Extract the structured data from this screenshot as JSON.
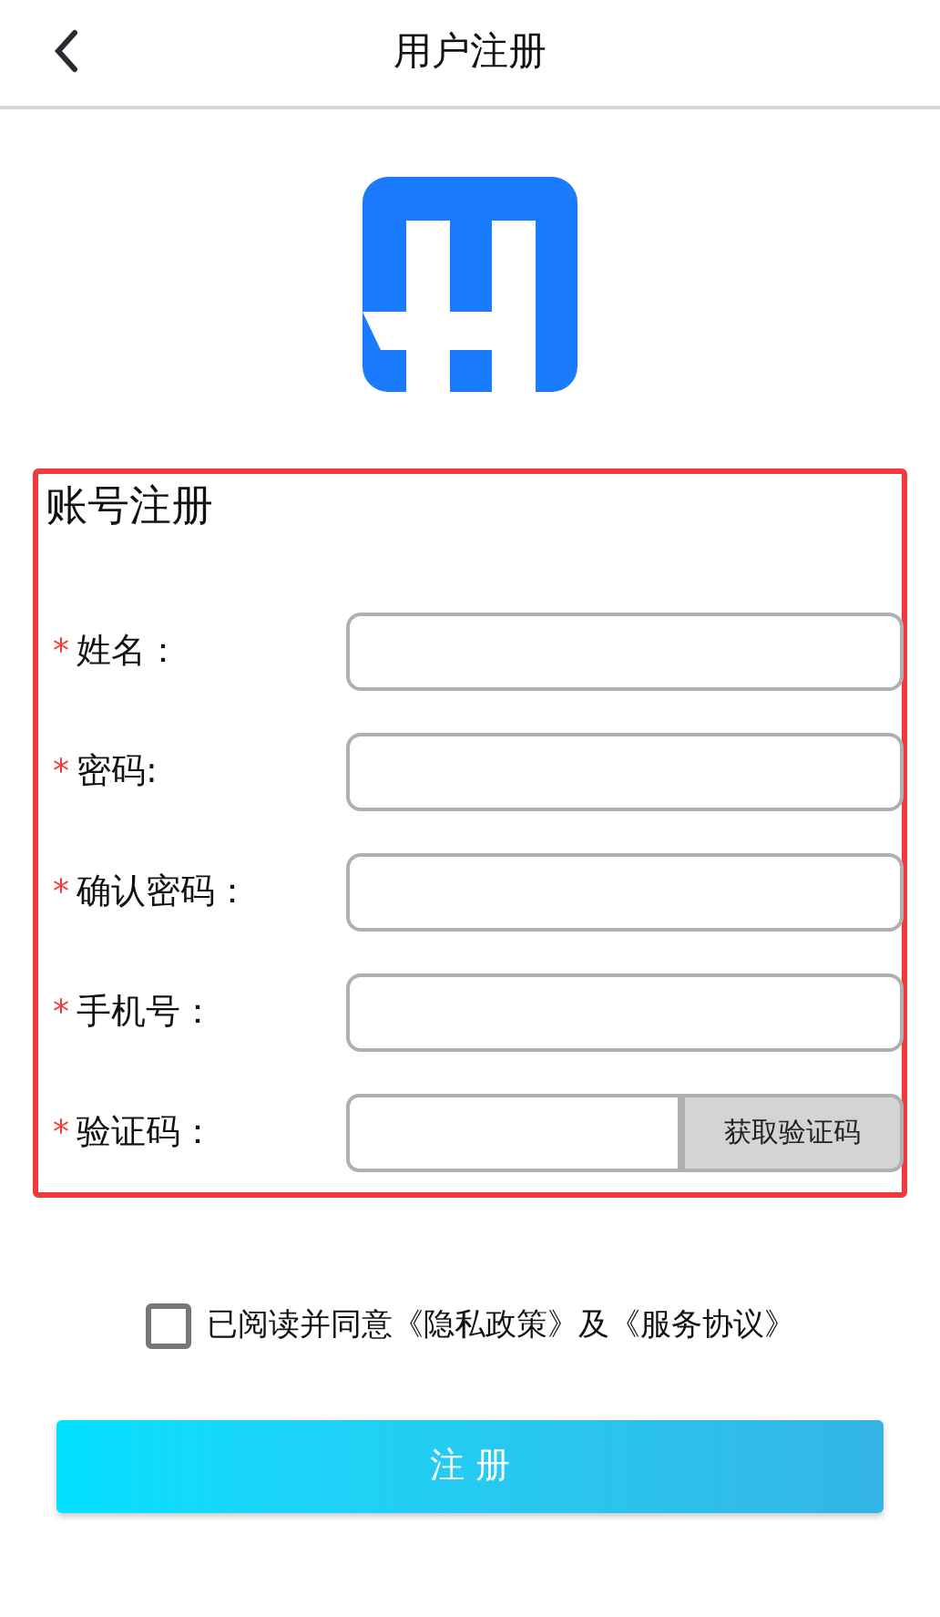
{
  "header": {
    "title": "用户注册"
  },
  "form": {
    "title": "账号注册",
    "fields": [
      {
        "kind": "text",
        "label": "姓名：",
        "required": true
      },
      {
        "kind": "text",
        "label": "密码:",
        "required": true
      },
      {
        "kind": "text",
        "label": "确认密码：",
        "required": true
      },
      {
        "kind": "text",
        "label": "手机号：",
        "required": true
      },
      {
        "kind": "code",
        "label": "验证码：",
        "required": true,
        "button": "获取验证码"
      }
    ],
    "required_mark": "*"
  },
  "agreement": {
    "checked": false,
    "text": "已阅读并同意《隐私政策》及《服务协议》"
  },
  "submit": "注 册"
}
